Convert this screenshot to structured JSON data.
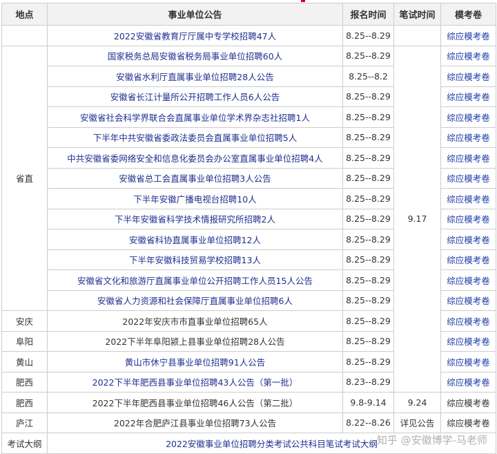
{
  "headers": {
    "region": "地点",
    "announcement": "事业单位公告",
    "signup": "报名时间",
    "exam": "笔试时间",
    "mock": "模考卷"
  },
  "rows": [
    {
      "region": "",
      "announcement": "2022安徽省教育厅厅属中专学校招聘47人",
      "signup": "8.25--8.29",
      "exam": "",
      "mock": "综应模考卷"
    },
    {
      "region": "省直",
      "announcement": "国家税务总局安徽省税务局事业单位招聘60人",
      "signup": "8.25--8.29",
      "exam": "9.17",
      "mock": "综应模考卷"
    },
    {
      "region": "",
      "announcement": "安徽省水利厅直属事业单位招聘28人公告",
      "signup": "8.25--8.2",
      "exam": "",
      "mock": "综应模考卷"
    },
    {
      "region": "",
      "announcement": "安徽省长江计量所公开招聘工作人员6人公告",
      "signup": "8.25--8.29",
      "exam": "",
      "mock": "综应模考卷"
    },
    {
      "region": "",
      "announcement": "安徽省社会科学界联合会直属事业单位学术界杂志社招聘1人",
      "signup": "8.25--8.29",
      "exam": "",
      "mock": "综应模考卷"
    },
    {
      "region": "",
      "announcement": "下半年中共安徽省委政法委员会直属事业单位招聘5人",
      "signup": "8.25--8.29",
      "exam": "",
      "mock": "综应模考卷"
    },
    {
      "region": "",
      "announcement": "中共安徽省委网络安全和信息化委员会办公室直属事业单位招聘4人",
      "signup": "8.25--8.29",
      "exam": "",
      "mock": "综应模考卷"
    },
    {
      "region": "",
      "announcement": "安徽省总工会直属事业单位招聘3人公告",
      "signup": "8.25--8.29",
      "exam": "",
      "mock": "综应模考卷"
    },
    {
      "region": "",
      "announcement": "下半年安徽广播电视台招聘10人",
      "signup": "8.25--8.29",
      "exam": "",
      "mock": "综应模考卷"
    },
    {
      "region": "",
      "announcement": "下半年安徽省科学技术情报研究所招聘2人",
      "signup": "8.25--8.29",
      "exam": "",
      "mock": "综应模考卷"
    },
    {
      "region": "",
      "announcement": "安徽省科协直属事业单位招聘12人",
      "signup": "8.25--8.29",
      "exam": "",
      "mock": "综应模考卷"
    },
    {
      "region": "",
      "announcement": "下半年安徽科技贸易学校招聘13人",
      "signup": "8.25--8.29",
      "exam": "",
      "mock": "综应模考卷"
    },
    {
      "region": "",
      "announcement": "安徽省文化和旅游厅直属事业单位公开招聘工作人员15人公告",
      "signup": "8.25--8.29",
      "exam": "",
      "mock": "综应模考卷"
    },
    {
      "region": "",
      "announcement": "安徽省人力资源和社会保障厅直属事业单位招聘6人",
      "signup": "8.25--8.29",
      "exam": "",
      "mock": "综应模考卷"
    },
    {
      "region": "安庆",
      "announcement": "2022年安庆市市直事业单位招聘65人",
      "signup": "8.25--8.29",
      "exam": "",
      "mock": "综应模考卷"
    },
    {
      "region": "阜阳",
      "announcement": "2022下半年阜阳颍上县事业单位招聘28人公告",
      "signup": "8.25--8.29",
      "exam": "",
      "mock": "综应模考卷"
    },
    {
      "region": "黄山",
      "announcement": "黄山市休宁县事业单位招聘91人公告",
      "signup": "8.25--8.29",
      "exam": "",
      "mock": "综应模考卷"
    },
    {
      "region": "肥西",
      "announcement": "2022下半年肥西县事业单位招聘43人公告（第一批）",
      "signup": "8.23--8.29",
      "exam": "",
      "mock": "综应模考卷"
    },
    {
      "region": "肥西",
      "announcement": "2022下半年肥西县事业单位招聘46人公告（第二批）",
      "signup": "9.8-9.14",
      "exam": "9.24",
      "mock": "综应模考卷"
    },
    {
      "region": "庐江",
      "announcement": "2022年合肥庐江县事业单位招聘73人公告",
      "signup": "8.22--8.26",
      "exam": "详见公告",
      "mock": "综应模考卷"
    }
  ],
  "footer": {
    "label": "考试大纲",
    "text": "2022安徽事业单位招聘分类考试公共科目笔试考试大纲"
  },
  "watermark": "知乎 @安徽博学-马老师",
  "colors": {
    "link": "#1f3fa6",
    "announcement": "#1f2f8f",
    "border": "#cccccc",
    "header_bg": "#f2f2f2"
  }
}
